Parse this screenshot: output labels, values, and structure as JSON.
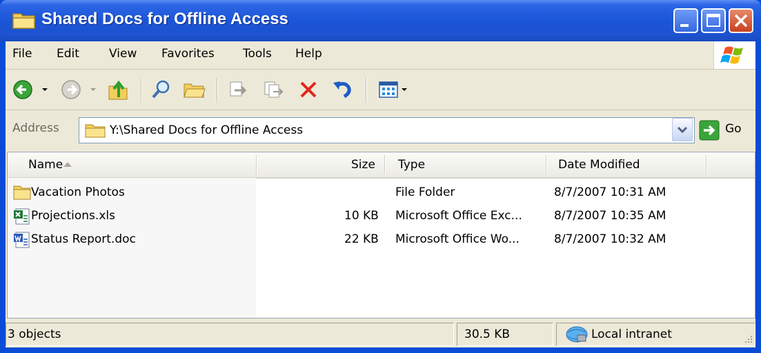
{
  "window": {
    "title": "Shared Docs for Offline Access"
  },
  "menu": {
    "items": [
      "File",
      "Edit",
      "View",
      "Favorites",
      "Tools",
      "Help"
    ]
  },
  "toolbar": {
    "icons": [
      "back-icon",
      "forward-icon",
      "up-folder-icon",
      "search-icon",
      "folders-icon",
      "move-to-icon",
      "copy-to-icon",
      "delete-icon",
      "undo-icon",
      "views-icon"
    ]
  },
  "address": {
    "label": "Address",
    "value": "Y:\\Shared Docs for Offline Access",
    "go_label": "Go"
  },
  "columns": {
    "name": "Name",
    "size": "Size",
    "type": "Type",
    "date": "Date Modified"
  },
  "files": [
    {
      "name": "Vacation Photos",
      "size": "",
      "type": "File Folder",
      "date": "8/7/2007 10:31 AM",
      "icon": "folder-icon"
    },
    {
      "name": "Projections.xls",
      "size": "10 KB",
      "type": "Microsoft Office Exc...",
      "date": "8/7/2007 10:35 AM",
      "icon": "excel-file-icon"
    },
    {
      "name": "Status Report.doc",
      "size": "22 KB",
      "type": "Microsoft Office Wo...",
      "date": "8/7/2007 10:32 AM",
      "icon": "word-file-icon"
    }
  ],
  "status": {
    "objects": "3 objects",
    "total_size": "30.5 KB",
    "zone": "Local intranet"
  },
  "colors": {
    "title_bar": "#2c66e6",
    "close_button": "#c9401e",
    "chrome": "#ece9d8"
  }
}
